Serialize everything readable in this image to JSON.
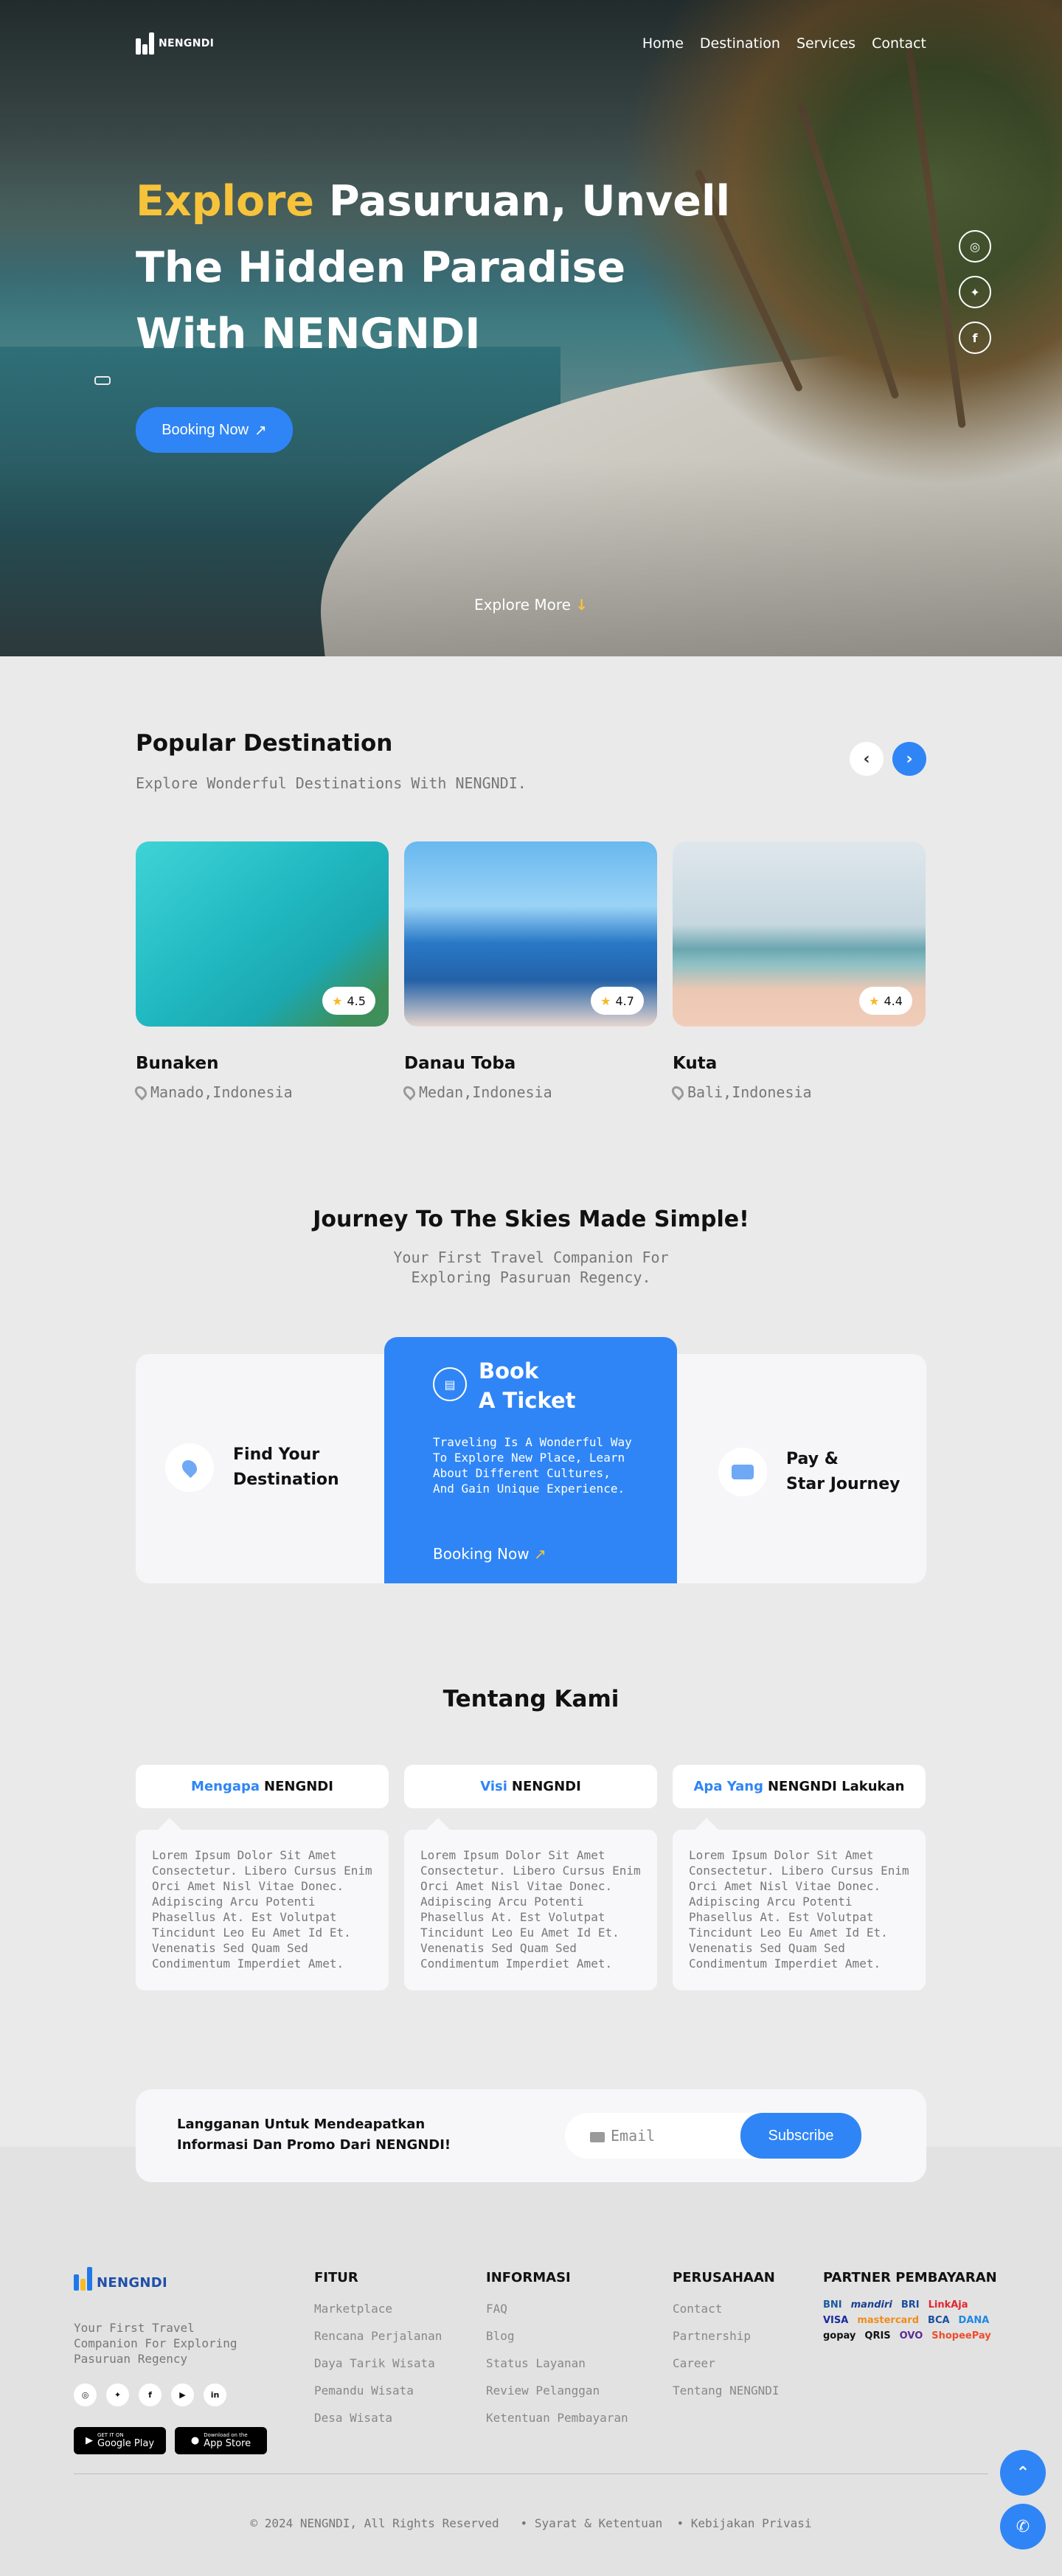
{
  "brand": {
    "logo_text": "NENGNDI"
  },
  "nav": {
    "items": [
      "Home",
      "Destination",
      "Services",
      "Contact"
    ]
  },
  "hero": {
    "title_highlight": "Explore",
    "title_rest": " Pasuruan, Unvell The Hidden Paradise With NENGNDI",
    "booking_label": "Booking Now",
    "explore_more": "Explore More"
  },
  "popular": {
    "title": "Popular Destination",
    "subtitle": "Explore Wonderful Destinations With NENGNDI.",
    "cards": [
      {
        "name": "Bunaken",
        "location": "Manado,Indonesia",
        "rating": "4.5"
      },
      {
        "name": "Danau Toba",
        "location": "Medan,Indonesia",
        "rating": "4.7"
      },
      {
        "name": "Kuta",
        "location": "Bali,Indonesia",
        "rating": "4.4"
      }
    ]
  },
  "journey": {
    "title": "Journey To The Skies Made Simple!",
    "subtitle_line1": "Your First Travel Companion For",
    "subtitle_line2": "Exploring Pasuruan Regency.",
    "step1_line1": "Find Your",
    "step1_line2": "Destination",
    "book_title_line1": "Book",
    "book_title_line2": "A Ticket",
    "book_desc": "Traveling Is A Wonderful Way To Explore New Place, Learn About Different Cultures, And Gain Unique Experience.",
    "book_button": "Booking Now",
    "step3_line1": "Pay &",
    "step3_line2": "Star Journey"
  },
  "about": {
    "title": "Tentang Kami",
    "tabs": [
      {
        "blue": "Mengapa",
        "rest": "NENGNDI"
      },
      {
        "blue": "Visi",
        "rest": "NENGNDI"
      },
      {
        "blue": "Apa Yang",
        "rest": "NENGNDI Lakukan"
      }
    ],
    "body": "Lorem Ipsum Dolor Sit Amet Consectetur. Libero Cursus Enim Orci Amet Nisl Vitae Donec. Adipiscing Arcu Potenti Phasellus At. Est Volutpat Tincidunt Leo Eu Amet Id Et. Venenatis Sed Quam Sed Condimentum Imperdiet Amet."
  },
  "subscribe": {
    "text_line1": "Langganan Untuk Mendeapatkan",
    "text_line2": "Informasi Dan Promo Dari NENGNDI!",
    "email_placeholder": "Email",
    "button": "Subscribe"
  },
  "footer": {
    "tagline": "Your First Travel Companion For Exploring Pasuruan Regency",
    "store1_small": "GET IT ON",
    "store1": "Google Play",
    "store2_small": "Download on the",
    "store2": "App Store",
    "fitur": {
      "title": "FITUR",
      "items": [
        "Marketplace",
        "Rencana Perjalanan",
        "Daya Tarik Wisata",
        "Pemandu Wisata",
        "Desa Wisata"
      ]
    },
    "informasi": {
      "title": "INFORMASI",
      "items": [
        "FAQ",
        "Blog",
        "Status Layanan",
        "Review Pelanggan",
        "Ketentuan Pembayaran"
      ]
    },
    "perusahaan": {
      "title": "PERUSAHAAN",
      "items": [
        "Contact",
        "Partnership",
        "Career",
        "Tentang NENGNDI"
      ]
    },
    "partner": {
      "title": "PARTNER PEMBAYARAN",
      "items": [
        "BNI",
        "mandiri",
        "BRI",
        "LinkAja",
        "VISA",
        "mastercard",
        "BCA",
        "DANA",
        "gopay",
        "QRIS",
        "OVO",
        "ShopeePay"
      ]
    },
    "copyright": "© 2024 NENGNDI, All Rights Reserved",
    "link1": "Syarat & Ketentuan",
    "link2": "Kebijakan Privasi"
  },
  "colors": {
    "accent": "#2f85f5",
    "highlight": "#f7c33a"
  }
}
